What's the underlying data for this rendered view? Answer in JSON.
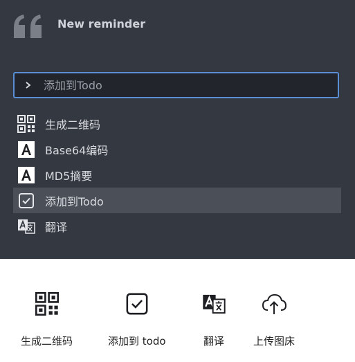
{
  "header": {
    "title": "New reminder"
  },
  "search": {
    "placeholder": "添加到Todo"
  },
  "commands": [
    {
      "label": "生成二维码",
      "icon": "qr-code-icon"
    },
    {
      "label": "Base64编码",
      "icon": "letter-a-icon"
    },
    {
      "label": "MD5摘要",
      "icon": "letter-a-icon"
    },
    {
      "label": "添加到Todo",
      "icon": "checkbox-icon",
      "selected": true
    },
    {
      "label": "翻译",
      "icon": "translate-icon"
    }
  ],
  "actions": [
    {
      "label": "生成二维码",
      "icon": "qr-code-icon"
    },
    {
      "label": "添加到 todo",
      "icon": "checkbox-icon"
    },
    {
      "label": "翻译",
      "icon": "translate-icon"
    },
    {
      "label": "上传图床",
      "icon": "cloud-upload-icon"
    }
  ],
  "colors": {
    "panel_bg": "#343840",
    "accent_border": "#5a8fd6",
    "selected_row": "#4a4f58"
  }
}
